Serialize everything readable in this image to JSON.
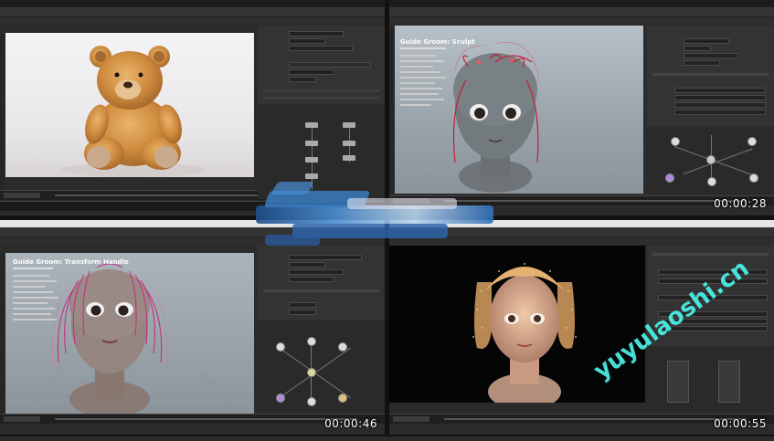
{
  "clips": [
    {
      "id": "top-left",
      "timestamp": "",
      "viewport_title": ""
    },
    {
      "id": "top-right",
      "timestamp": "00:00:28",
      "viewport_title": "Guide Groom: Sculpt"
    },
    {
      "id": "bottom-left",
      "timestamp": "00:00:46",
      "viewport_title": "Guide Groom: Transform Handle"
    },
    {
      "id": "bottom-right",
      "timestamp": "00:00:55",
      "viewport_title": ""
    }
  ],
  "watermark": "yuyulaoshi.cn",
  "colors": {
    "ui_bg": "#2b2b2b",
    "viewport_grey": "#9aa3a8",
    "render_black": "#050505",
    "watermark": "#4af2e8",
    "guide_red": "#c0203a",
    "guide_pink": "#d0307a",
    "brush_blue": "#2f6fb8"
  },
  "icons": [
    "play-icon",
    "node-icon",
    "teddy-bear-render",
    "character-head-render"
  ]
}
